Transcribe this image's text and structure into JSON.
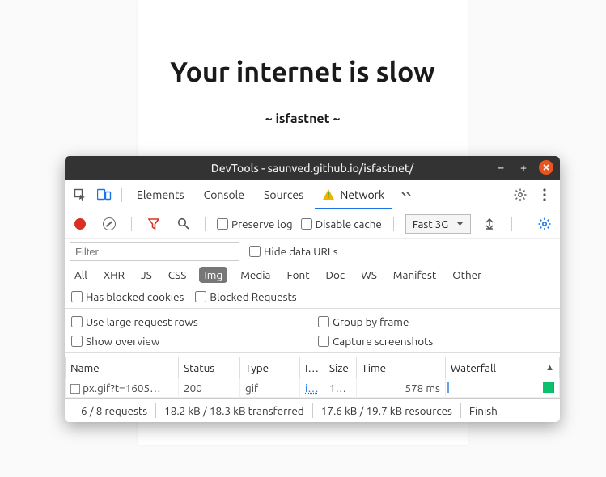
{
  "page": {
    "title": "Your internet is slow",
    "subtitle": "~ isfastnet ~"
  },
  "titlebar": {
    "text": "DevTools - saunved.github.io/isfastnet/"
  },
  "tabs": {
    "elements": "Elements",
    "console": "Console",
    "sources": "Sources",
    "network": "Network"
  },
  "toolbar": {
    "preserve_log": "Preserve log",
    "disable_cache": "Disable cache",
    "throttling": "Fast 3G"
  },
  "filter": {
    "placeholder": "Filter",
    "hide_urls": "Hide data URLs"
  },
  "types": {
    "all": "All",
    "xhr": "XHR",
    "js": "JS",
    "css": "CSS",
    "img": "Img",
    "media": "Media",
    "font": "Font",
    "doc": "Doc",
    "ws": "WS",
    "manifest": "Manifest",
    "other": "Other"
  },
  "opts1": {
    "blocked_cookies": "Has blocked cookies",
    "blocked_requests": "Blocked Requests"
  },
  "opts2": {
    "large_rows": "Use large request rows",
    "group_frame": "Group by frame",
    "show_overview": "Show overview",
    "capture_ss": "Capture screenshots"
  },
  "table": {
    "headers": {
      "name": "Name",
      "status": "Status",
      "type": "Type",
      "initiator": "I…",
      "size": "Size",
      "time": "Time",
      "waterfall": "Waterfall"
    },
    "row": {
      "name": "px.gif?t=1605…",
      "status": "200",
      "type": "gif",
      "initiator": "i…",
      "size": "1…",
      "time": "578 ms"
    }
  },
  "status": {
    "requests": "6 / 8 requests",
    "transferred": "18.2 kB / 18.3 kB transferred",
    "resources": "17.6 kB / 19.7 kB resources",
    "finish": "Finish"
  }
}
